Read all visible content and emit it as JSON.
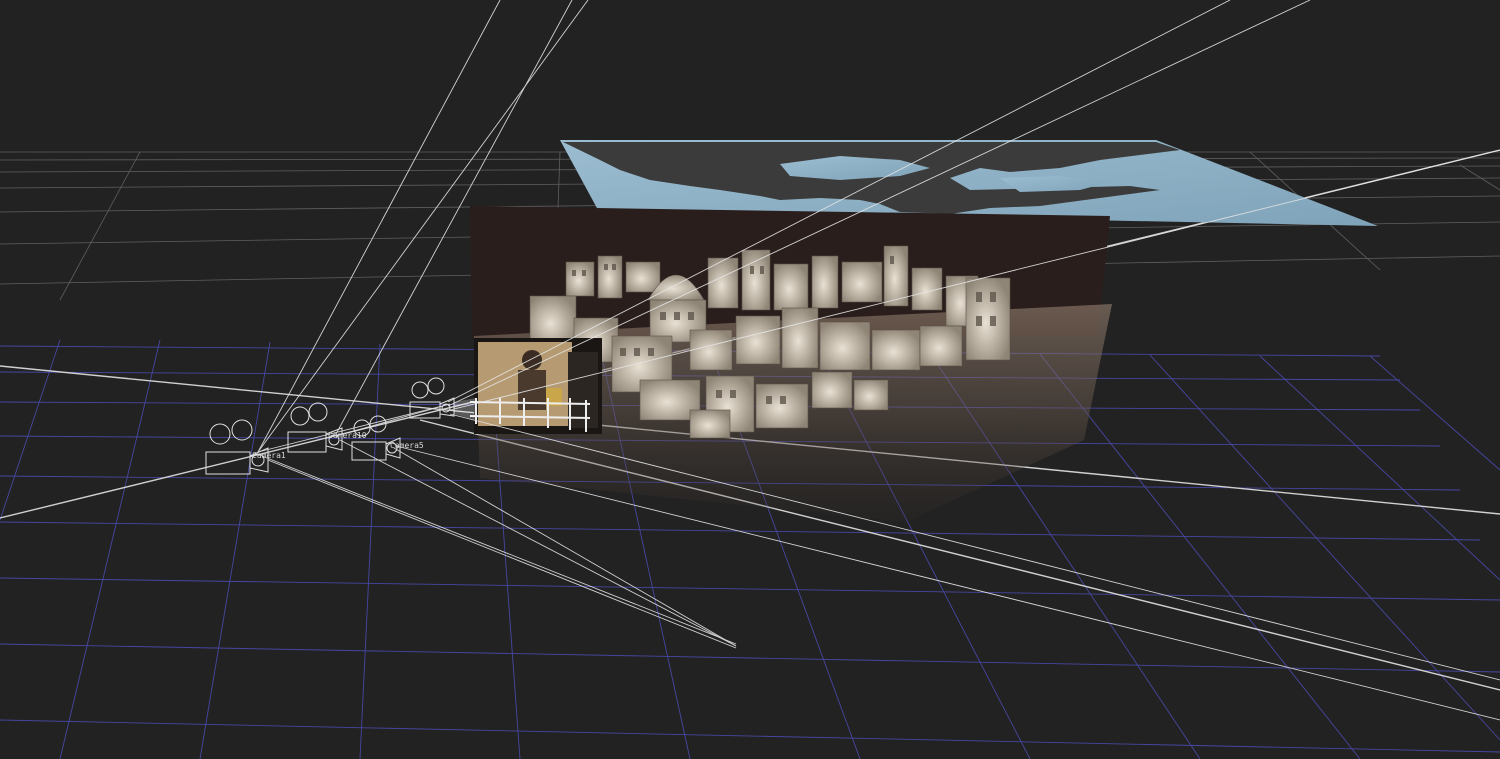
{
  "viewport": {
    "background_color": "#222222",
    "grid_color": "#6a6a6a",
    "floor_grid_color": "#4b4bb0",
    "frustum_line_color": "#e6e6e6"
  },
  "sky_plane": {
    "sky_color": "#8fb2c8",
    "cloud_color": "#3b3b3b"
  },
  "city_set": {
    "backdrop_color": "#2a1e1c",
    "building_color": "#c9c0b2",
    "ground_color": "#6b5a4e"
  },
  "cameras": [
    {
      "name": "camera-1",
      "label": "Camera1"
    },
    {
      "name": "camera-10",
      "label": "Camera10"
    },
    {
      "name": "camera-5",
      "label": "Camera5"
    },
    {
      "name": "camera-active",
      "label": ""
    }
  ]
}
